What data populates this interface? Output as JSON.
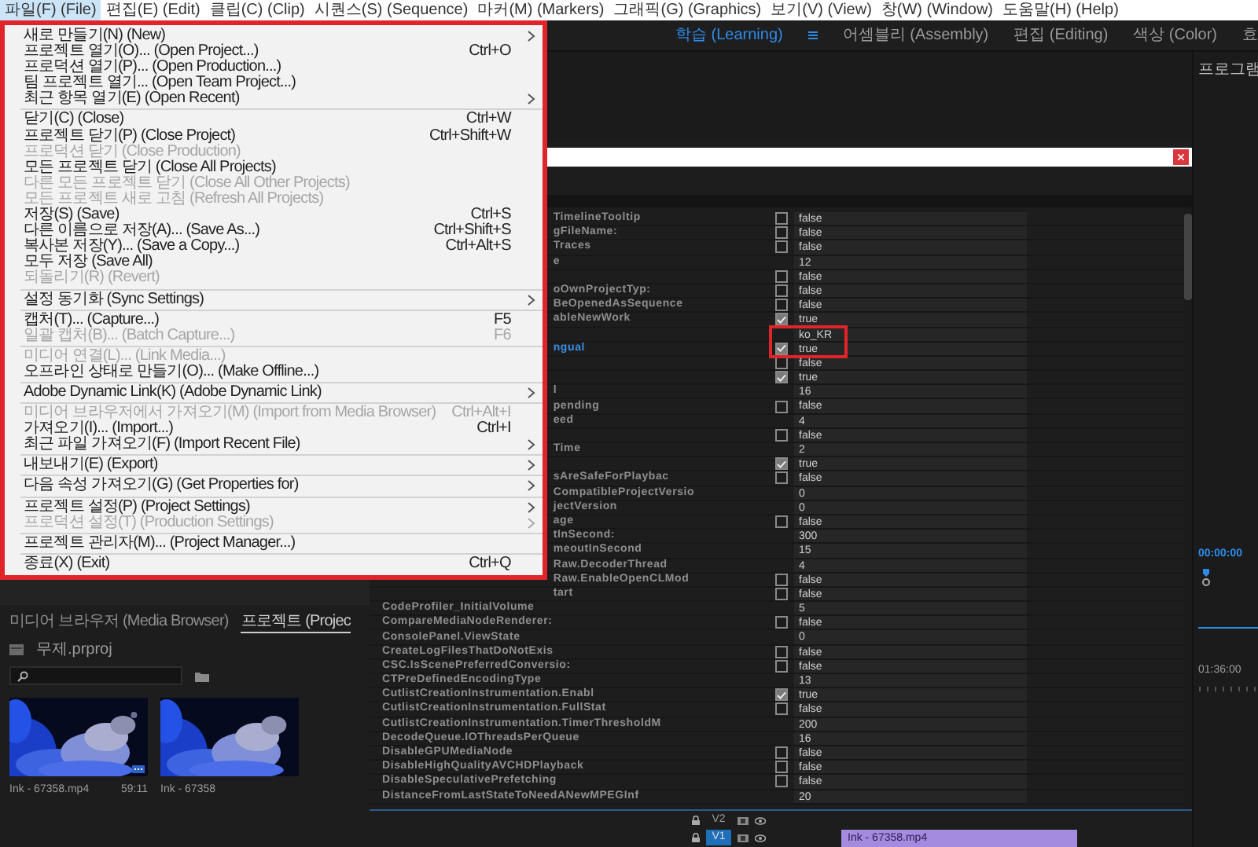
{
  "menubar": [
    {
      "label": "파일(F) (File)",
      "selected": true
    },
    {
      "label": "편집(E) (Edit)",
      "selected": false
    },
    {
      "label": "클립(C) (Clip)",
      "selected": false
    },
    {
      "label": "시퀀스(S) (Sequence)",
      "selected": false
    },
    {
      "label": "마커(M) (Markers)",
      "selected": false
    },
    {
      "label": "그래픽(G) (Graphics)",
      "selected": false
    },
    {
      "label": "보기(V) (View)",
      "selected": false
    },
    {
      "label": "창(W) (Window)",
      "selected": false
    },
    {
      "label": "도움말(H) (Help)",
      "selected": false
    }
  ],
  "workspaces": [
    {
      "label": "학습 (Learning)",
      "selected": true
    },
    {
      "label": "어셈블리 (Assembly)",
      "selected": false
    },
    {
      "label": "편집 (Editing)",
      "selected": false
    },
    {
      "label": "색상 (Color)",
      "selected": false
    },
    {
      "label": "효",
      "selected": false
    }
  ],
  "file_menu": {
    "groups": [
      {
        "items": [
          {
            "label": "새로 만들기(N) (New)",
            "submenu": true,
            "disabled": false
          },
          {
            "label": "프로젝트 열기(O)... (Open Project...)",
            "shortcut": "Ctrl+O",
            "submenu": false,
            "disabled": false
          },
          {
            "label": "프로덕션 열기(P)... (Open Production...)",
            "submenu": false,
            "disabled": false
          },
          {
            "label": "팀 프로젝트 열기... (Open Team Project...)",
            "submenu": false,
            "disabled": false
          },
          {
            "label": "최근 항목 열기(E) (Open Recent)",
            "submenu": true,
            "disabled": false
          }
        ]
      },
      {
        "items": [
          {
            "label": "닫기(C) (Close)",
            "shortcut": "Ctrl+W",
            "submenu": false,
            "disabled": false
          },
          {
            "label": "프로젝트 닫기(P) (Close Project)",
            "shortcut": "Ctrl+Shift+W",
            "submenu": false,
            "disabled": false
          },
          {
            "label": "프로덕션 닫기 (Close Production)",
            "submenu": false,
            "disabled": true
          },
          {
            "label": "모든 프로젝트 닫기 (Close All Projects)",
            "submenu": false,
            "disabled": false
          },
          {
            "label": "다른 모든 프로젝트 닫기 (Close All Other Projects)",
            "submenu": false,
            "disabled": true
          },
          {
            "label": "모든 프로젝트 새로 고침 (Refresh All Projects)",
            "submenu": false,
            "disabled": true
          },
          {
            "label": "저장(S) (Save)",
            "shortcut": "Ctrl+S",
            "submenu": false,
            "disabled": false
          },
          {
            "label": "다른 이름으로 저장(A)... (Save As...)",
            "shortcut": "Ctrl+Shift+S",
            "submenu": false,
            "disabled": false
          },
          {
            "label": "복사본 저장(Y)... (Save a Copy...)",
            "shortcut": "Ctrl+Alt+S",
            "submenu": false,
            "disabled": false
          },
          {
            "label": "모두 저장 (Save All)",
            "submenu": false,
            "disabled": false
          },
          {
            "label": "되돌리기(R) (Revert)",
            "submenu": false,
            "disabled": true
          }
        ]
      },
      {
        "items": [
          {
            "label": "설정 동기화 (Sync Settings)",
            "submenu": true,
            "disabled": false
          }
        ]
      },
      {
        "items": [
          {
            "label": "캡처(T)... (Capture...)",
            "shortcut": "F5",
            "submenu": false,
            "disabled": false
          },
          {
            "label": "일괄 캡처(B)... (Batch Capture...)",
            "shortcut": "F6",
            "submenu": false,
            "disabled": true
          }
        ]
      },
      {
        "items": [
          {
            "label": "미디어 연결(L)... (Link Media...)",
            "submenu": false,
            "disabled": true
          },
          {
            "label": "오프라인 상태로 만들기(O)... (Make Offline...)",
            "submenu": false,
            "disabled": false
          }
        ]
      },
      {
        "items": [
          {
            "label": "Adobe Dynamic Link(K) (Adobe Dynamic Link)",
            "submenu": true,
            "disabled": false
          }
        ]
      },
      {
        "items": [
          {
            "label": "미디어 브라우저에서 가져오기(M) (Import from Media Browser)",
            "shortcut": "Ctrl+Alt+I",
            "submenu": false,
            "disabled": true
          },
          {
            "label": "가져오기(I)... (Import...)",
            "shortcut": "Ctrl+I",
            "submenu": false,
            "disabled": false
          },
          {
            "label": "최근 파일 가져오기(F) (Import Recent File)",
            "submenu": true,
            "disabled": false
          }
        ]
      },
      {
        "items": [
          {
            "label": "내보내기(E) (Export)",
            "submenu": true,
            "disabled": false
          }
        ]
      },
      {
        "items": [
          {
            "label": "다음 속성 가져오기(G) (Get Properties for)",
            "submenu": true,
            "disabled": false
          }
        ]
      },
      {
        "items": [
          {
            "label": "프로젝트 설정(P) (Project Settings)",
            "submenu": true,
            "disabled": false
          },
          {
            "label": "프로덕션 설정(T) (Production Settings)",
            "submenu": true,
            "disabled": true
          }
        ]
      },
      {
        "items": [
          {
            "label": "프로젝트 관리자(M)... (Project Manager...)",
            "submenu": false,
            "disabled": false
          }
        ]
      },
      {
        "items": [
          {
            "label": "종료(X) (Exit)",
            "shortcut": "Ctrl+Q",
            "submenu": false,
            "disabled": false
          }
        ]
      }
    ]
  },
  "console": {
    "rows_behind_menu": [
      {
        "name": "TimelineTooltip",
        "kind": "bool",
        "checked": false,
        "value": "false",
        "selected": false,
        "highlighted": false
      },
      {
        "name": "gFileName:",
        "kind": "bool",
        "checked": false,
        "value": "false",
        "selected": false,
        "highlighted": false
      },
      {
        "name": "Traces",
        "kind": "bool",
        "checked": false,
        "value": "false",
        "selected": false,
        "highlighted": false
      },
      {
        "name": "e",
        "kind": "value",
        "value": "12",
        "selected": false,
        "highlighted": false
      },
      {
        "kind": "bool",
        "checked": false,
        "value": "false",
        "selected": false,
        "highlighted": false
      },
      {
        "name": "oOwnProjectTyp:",
        "kind": "bool",
        "checked": false,
        "value": "false",
        "selected": false,
        "highlighted": false
      },
      {
        "name": "BeOpenedAsSequence",
        "kind": "bool",
        "checked": false,
        "value": "false",
        "selected": false,
        "highlighted": false
      },
      {
        "name": "ableNewWork",
        "kind": "bool",
        "checked": true,
        "value": "true",
        "selected": false,
        "highlighted": false
      },
      {
        "kind": "value",
        "value": "ko_KR",
        "selected": false,
        "highlighted": true
      },
      {
        "name": "ngual",
        "kind": "bool",
        "checked": true,
        "value": "true",
        "selected": true,
        "highlighted": true
      },
      {
        "kind": "bool",
        "checked": false,
        "value": "false",
        "selected": false,
        "highlighted": false
      },
      {
        "kind": "bool",
        "checked": true,
        "value": "true",
        "selected": false,
        "highlighted": false
      },
      {
        "name": "l",
        "kind": "value",
        "value": "16",
        "selected": false,
        "highlighted": false
      },
      {
        "name": "pending",
        "kind": "bool",
        "checked": false,
        "value": "false",
        "selected": false,
        "highlighted": false
      },
      {
        "name": "eed",
        "kind": "value",
        "value": "4",
        "selected": false,
        "highlighted": false
      },
      {
        "kind": "bool",
        "checked": false,
        "value": "false",
        "selected": false,
        "highlighted": false
      },
      {
        "name": "Time",
        "kind": "value",
        "value": "2",
        "selected": false,
        "highlighted": false
      },
      {
        "kind": "bool",
        "checked": true,
        "value": "true",
        "selected": false,
        "highlighted": false
      },
      {
        "name": "sAreSafeForPlaybac",
        "kind": "bool",
        "checked": false,
        "value": "false",
        "selected": false,
        "highlighted": false
      },
      {
        "name": "CompatibleProjectVersio",
        "kind": "value",
        "value": "0",
        "selected": false,
        "highlighted": false
      },
      {
        "name": "jectVersion",
        "kind": "value",
        "value": "0",
        "selected": false,
        "highlighted": false
      },
      {
        "name": "age",
        "kind": "bool",
        "checked": false,
        "value": "false",
        "selected": false,
        "highlighted": false
      },
      {
        "name": "tInSecond:",
        "kind": "value",
        "value": "300",
        "selected": false,
        "highlighted": false
      },
      {
        "name": "meoutInSecond",
        "kind": "value",
        "value": "15",
        "selected": false,
        "highlighted": false
      },
      {
        "name": "Raw.DecoderThread",
        "kind": "value",
        "value": "4",
        "selected": false,
        "highlighted": false
      },
      {
        "name": "Raw.EnableOpenCLMod",
        "kind": "bool",
        "checked": false,
        "value": "false",
        "selected": false,
        "highlighted": false
      },
      {
        "name": "tart",
        "kind": "bool",
        "checked": false,
        "value": "false",
        "selected": false,
        "highlighted": false
      }
    ],
    "rows_below_menu": [
      {
        "name": "CodeProfiler_InitialVolume",
        "kind": "value",
        "value": "5",
        "selected": false,
        "highlighted": false
      },
      {
        "name": "CompareMediaNodeRenderer:",
        "kind": "bool",
        "checked": false,
        "value": "false",
        "selected": false,
        "highlighted": false
      },
      {
        "name": "ConsolePanel.ViewState",
        "kind": "value",
        "value": "0",
        "selected": false,
        "highlighted": false
      },
      {
        "name": "CreateLogFilesThatDoNotExis",
        "kind": "bool",
        "checked": false,
        "value": "false",
        "selected": false,
        "highlighted": false
      },
      {
        "name": "CSC.IsScenePreferredConversio:",
        "kind": "bool",
        "checked": false,
        "value": "false",
        "selected": false,
        "highlighted": false
      },
      {
        "name": "CTPreDefinedEncodingType",
        "kind": "value",
        "value": "13",
        "selected": false,
        "highlighted": false
      },
      {
        "name": "CutlistCreationInstrumentation.Enabl",
        "kind": "bool",
        "checked": true,
        "value": "true",
        "selected": false,
        "highlighted": false
      },
      {
        "name": "CutlistCreationInstrumentation.FullStat",
        "kind": "bool",
        "checked": false,
        "value": "false",
        "selected": false,
        "highlighted": false
      },
      {
        "name": "CutlistCreationInstrumentation.TimerThresholdM",
        "kind": "value",
        "value": "200",
        "selected": false,
        "highlighted": false
      },
      {
        "name": "DecodeQueue.IOThreadsPerQueue",
        "kind": "value",
        "value": "16",
        "selected": false,
        "highlighted": false
      },
      {
        "name": "DisableGPUMediaNode",
        "kind": "bool",
        "checked": false,
        "value": "false",
        "selected": false,
        "highlighted": false
      },
      {
        "name": "DisableHighQualityAVCHDPlayback",
        "kind": "bool",
        "checked": false,
        "value": "false",
        "selected": false,
        "highlighted": false
      },
      {
        "name": "DisableSpeculativePrefetching",
        "kind": "bool",
        "checked": false,
        "value": "false",
        "selected": false,
        "highlighted": false
      },
      {
        "name": "DistanceFromLastStateToNeedANewMPEGInf",
        "kind": "value",
        "value": "20",
        "selected": false,
        "highlighted": false
      }
    ]
  },
  "project_panel": {
    "tabs": [
      {
        "label": "미디어 브라우저 (Media Browser)",
        "selected": false
      },
      {
        "label": "프로젝트 (Projec",
        "selected": true
      }
    ],
    "project_file": "무제.prproj",
    "items": [
      {
        "name": "Ink - 67358.mp4",
        "duration": "59:11"
      },
      {
        "name": "Ink - 67358"
      }
    ]
  },
  "timeline": {
    "tracks": [
      {
        "label": "V2",
        "selected": false
      },
      {
        "label": "V1",
        "selected": true,
        "clips": [
          {
            "name": "Ink - 67358.mp4"
          }
        ]
      }
    ]
  },
  "program_monitor": {
    "title": "프로그램",
    "timecode": "00:00:00",
    "ruler_time": "01:36:00"
  }
}
